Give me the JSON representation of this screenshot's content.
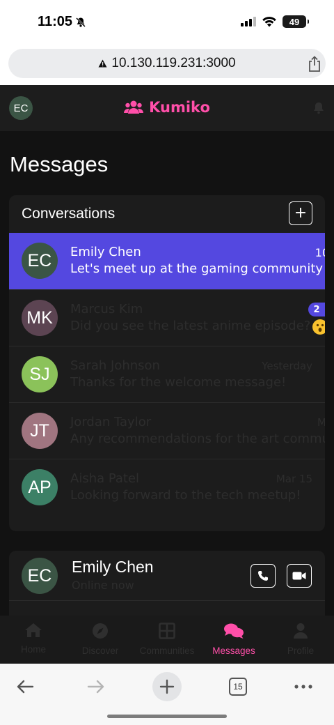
{
  "status_bar": {
    "time": "11:05",
    "battery": "49"
  },
  "browser": {
    "url": "10.130.119.231:3000",
    "tab_count": "15"
  },
  "app": {
    "user_initials": "EC",
    "brand": "Kumiko",
    "page_title": "Messages"
  },
  "conversations": {
    "title": "Conversations",
    "new_label": "+",
    "items": [
      {
        "initials": "EC",
        "name": "Emily Chen",
        "preview": "Let's meet up at the gaming community event!",
        "time": "10",
        "color": "#3b5545",
        "active": true
      },
      {
        "initials": "MK",
        "name": "Marcus Kim",
        "preview": "Did you see the latest anime episode?",
        "time": "",
        "unread": "2",
        "color": "#5c4452"
      },
      {
        "initials": "SJ",
        "name": "Sarah Johnson",
        "preview": "Thanks for the welcome message!",
        "time": "Yesterday",
        "color": "#8bc25a"
      },
      {
        "initials": "JT",
        "name": "Jordan Taylor",
        "preview": "Any recommendations for the art community?",
        "time": "M",
        "color": "#a07580"
      },
      {
        "initials": "AP",
        "name": "Aisha Patel",
        "preview": "Looking forward to the tech meetup!",
        "time": "Mar 15",
        "color": "#3c8066"
      }
    ]
  },
  "chat": {
    "initials": "EC",
    "name": "Emily Chen",
    "status": "Online now"
  },
  "nav": {
    "items": [
      {
        "label": "Home",
        "icon": "home-icon"
      },
      {
        "label": "Discover",
        "icon": "compass-icon"
      },
      {
        "label": "Communities",
        "icon": "grid-icon"
      },
      {
        "label": "Messages",
        "icon": "chat-bubbles-icon",
        "active": true
      },
      {
        "label": "Profile",
        "icon": "user-icon"
      }
    ]
  },
  "colors": {
    "accent": "#5448e0",
    "brand": "#ff4fa9",
    "background": "#121212",
    "card": "#1c1c1c"
  }
}
